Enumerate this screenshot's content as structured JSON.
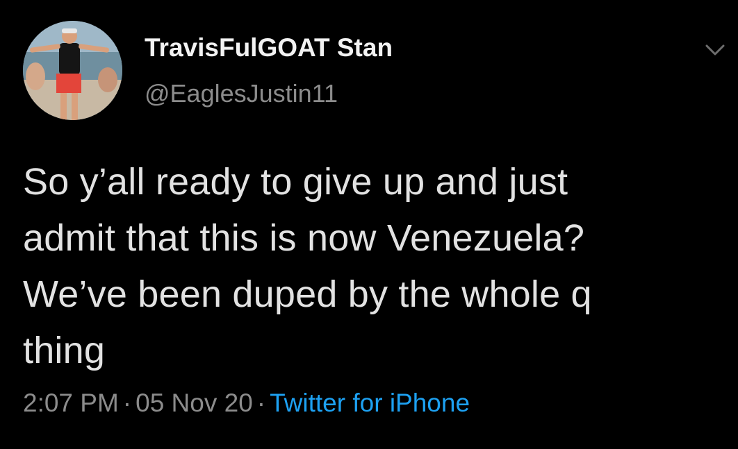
{
  "user": {
    "display_name": "TravisFulGOAT Stan",
    "handle": "@EaglesJustin11"
  },
  "tweet": {
    "lines": [
      "So y’all ready to give up and just",
      "admit that this is now Venezuela?",
      "We’ve been duped by the whole q",
      "thing"
    ],
    "time": "2:07 PM",
    "separator": "·",
    "date": "05 Nov 20",
    "source": "Twitter for iPhone"
  },
  "icons": {
    "menu": "chevron-down-icon"
  },
  "colors": {
    "background": "#000000",
    "text": "#e2e2e2",
    "muted": "#8c8c8c",
    "link": "#1da1f2"
  }
}
